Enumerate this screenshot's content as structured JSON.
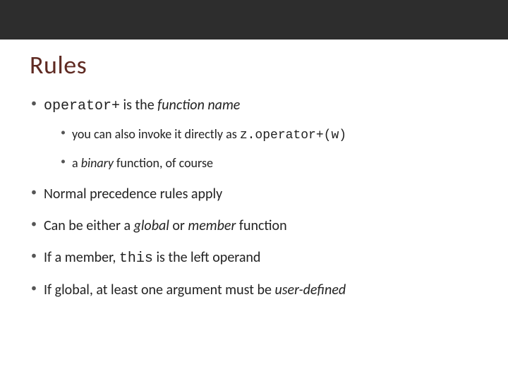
{
  "slide": {
    "title": "Rules",
    "bullets": [
      {
        "seg1_code": "operator+",
        "seg2": " is the ",
        "seg3_ital": "function name",
        "children": [
          {
            "seg1": "you can also invoke it directly as ",
            "seg2_code": "z.operator+(w)"
          },
          {
            "seg1": "a ",
            "seg2_ital": "binary",
            "seg3": " function, of course"
          }
        ]
      },
      {
        "seg1": "Normal precedence rules apply"
      },
      {
        "seg1": "Can be either a ",
        "seg2_ital": "global",
        "seg3": " or ",
        "seg4_ital": "member",
        "seg5": " function"
      },
      {
        "seg1": "If a member, ",
        "seg2_code": "this",
        "seg3": " is the left operand"
      },
      {
        "seg1": "If global, at least one argument must be ",
        "seg2_ital": "user-defined"
      }
    ]
  }
}
